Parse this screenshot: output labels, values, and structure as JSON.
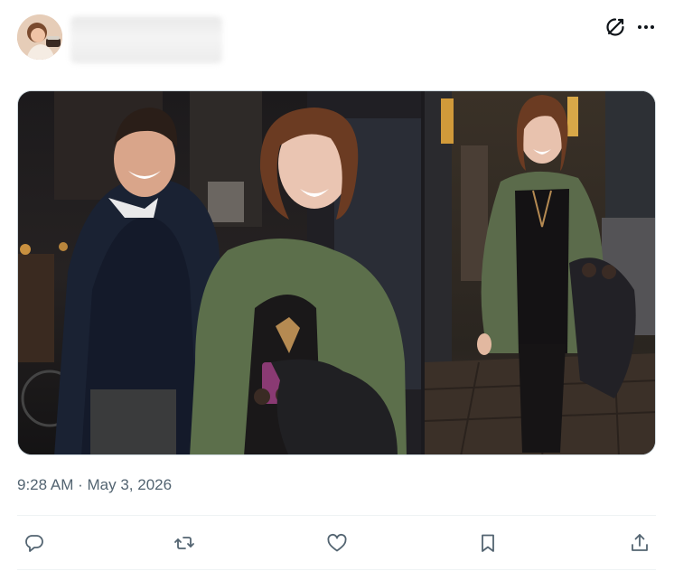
{
  "post": {
    "author_avatar_icon": "profile-avatar",
    "author_name_blurred": true,
    "media": {
      "count": 2,
      "left_photo_alt": "",
      "right_photo_alt": ""
    },
    "timestamp_time": "9:28 AM",
    "timestamp_separator": "·",
    "timestamp_date": "May 3, 2026"
  },
  "header_actions": {
    "grok_icon": "grok-icon",
    "more_icon": "more-horizontal-icon"
  },
  "action_bar": {
    "items": [
      {
        "name": "reply",
        "icon": "reply-icon"
      },
      {
        "name": "repost",
        "icon": "repost-icon"
      },
      {
        "name": "like",
        "icon": "heart-icon"
      },
      {
        "name": "bookmark",
        "icon": "bookmark-icon"
      },
      {
        "name": "share",
        "icon": "share-icon"
      }
    ]
  },
  "colors": {
    "secondary_text": "#536471",
    "icon": "#536471",
    "divider": "#eff3f4",
    "border": "#cfd9de"
  }
}
